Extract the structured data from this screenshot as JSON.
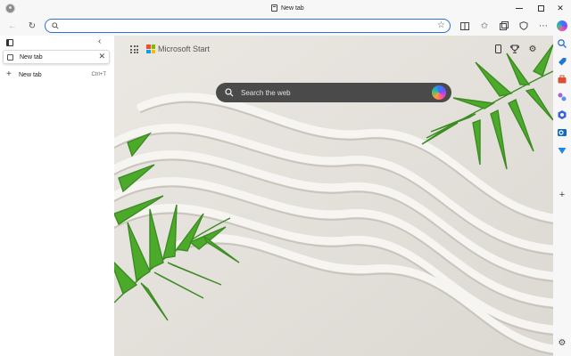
{
  "window": {
    "title": "New tab"
  },
  "address_bar": {
    "value": "",
    "placeholder": ""
  },
  "tab_pane": {
    "tabs": [
      {
        "label": "New tab"
      }
    ],
    "new_tab": {
      "label": "New tab",
      "shortcut": "Ctrl+T"
    }
  },
  "content": {
    "brand": "Microsoft Start",
    "search": {
      "placeholder": "Search the web"
    }
  },
  "colors": {
    "accent": "#2b6fd8",
    "search_bg": "#4a4a4a",
    "ms_logo": [
      "#f25022",
      "#7fba00",
      "#00a4ef",
      "#ffb900"
    ]
  },
  "icons": {
    "toolbar": [
      "back-arrow-icon",
      "refresh-icon",
      "search-icon",
      "favorite-star-icon",
      "split-screen-icon",
      "favorites-icon",
      "collections-icon",
      "browser-essentials-icon",
      "more-icon",
      "copilot-icon"
    ],
    "content": [
      "apps-grid-icon",
      "phone-icon",
      "rewards-trophy-icon",
      "settings-gear-icon"
    ],
    "sidebar": [
      "copilot-icon",
      "search-icon",
      "shopping-icon",
      "tools-icon",
      "games-icon",
      "microsoft-365-icon",
      "outlook-icon",
      "drop-icon",
      "add-icon",
      "sidebar-settings-icon"
    ]
  }
}
